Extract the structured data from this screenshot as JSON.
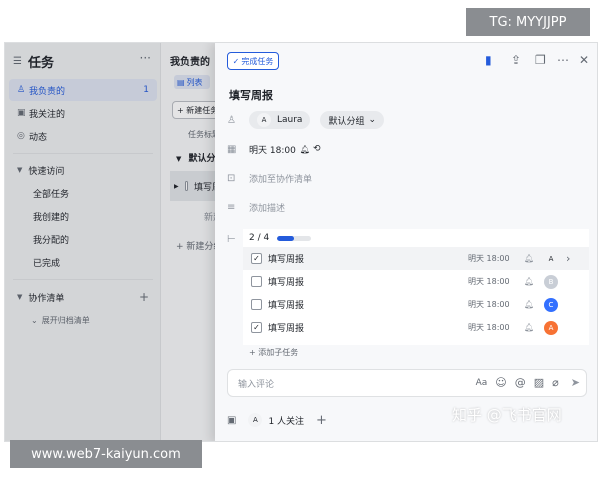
{
  "sidebar": {
    "title": "任务",
    "more": "···",
    "items": [
      {
        "label": "我负责的",
        "count": "1",
        "icon": "person-icon"
      },
      {
        "label": "我关注的",
        "count": "",
        "icon": "follow-icon"
      },
      {
        "label": "动态",
        "count": "",
        "icon": "activity-icon"
      }
    ],
    "quick_access": {
      "label": "快速访问",
      "items": [
        "全部任务",
        "我创建的",
        "我分配的",
        "已完成"
      ]
    },
    "collab": {
      "label": "协作清单",
      "expand": "展开归档清单"
    }
  },
  "list": {
    "title": "我负责的",
    "tab": "列表",
    "new_task": "+ 新建任务",
    "column": "任务标题",
    "group": "默认分组",
    "row_task": "填写周报",
    "add_row": "新建任务",
    "new_section": "+ 新建分组"
  },
  "panel": {
    "complete_btn": "完成任务",
    "title": "填写周报",
    "assignee": "Laura",
    "group": "默认分组",
    "due": "明天 18:00",
    "add_list": "添加至协作清单",
    "add_desc": "添加描述",
    "subtasks": {
      "progress_text": "2 / 4",
      "progress": 0.5,
      "items": [
        {
          "name": "填写周报",
          "due": "明天 18:00",
          "done": true,
          "avatar_color": "#f2f3f5",
          "avatar_text": "A"
        },
        {
          "name": "填写周报",
          "due": "明天 18:00",
          "done": false,
          "avatar_color": "#c9ced6",
          "avatar_text": "B"
        },
        {
          "name": "填写周报",
          "due": "明天 18:00",
          "done": false,
          "avatar_color": "#3370ff",
          "avatar_text": "C"
        },
        {
          "name": "填写周报",
          "due": "明天 18:00",
          "done": true,
          "avatar_color": "#f77234",
          "avatar_text": "A"
        }
      ],
      "add": "+ 添加子任务"
    },
    "comment_placeholder": "输入评论",
    "followers": "1 人关注"
  },
  "watermarks": {
    "top_right": "TG: MYYJJPP",
    "bottom_left": "www.web7-kaiyun.com",
    "bottom_right": "知乎 @飞书官网"
  },
  "colors": {
    "accent": "#245bdb"
  }
}
